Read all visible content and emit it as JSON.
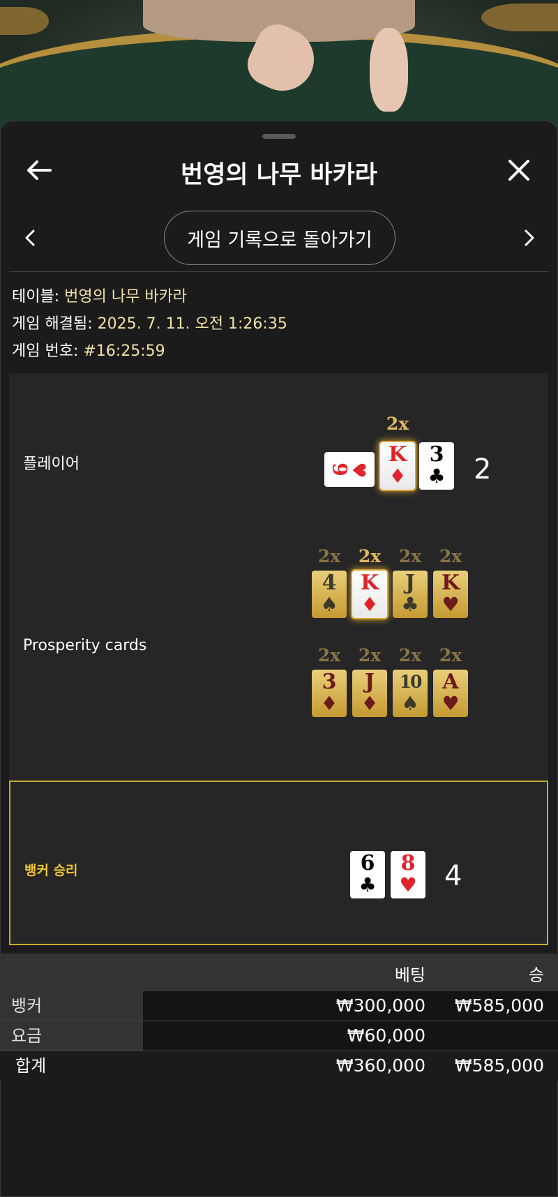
{
  "header": {
    "title": "번영의 나무 바카라",
    "back_label": "게임 기록으로 돌아가기"
  },
  "info": {
    "table_key": "테이블:",
    "table_value": "번영의 나무 바카라",
    "resolved_key": "게임 해결됨:",
    "resolved_value": "2025. 7. 11. 오전 1:26:35",
    "number_key": "게임 번호:",
    "number_value": "#16:25:59"
  },
  "player": {
    "label": "플레이어",
    "multiplier": "2x",
    "cards": [
      {
        "rank": "9",
        "suit": "♥",
        "color": "red"
      },
      {
        "rank": "K",
        "suit": "♦",
        "color": "red"
      },
      {
        "rank": "3",
        "suit": "♣",
        "color": "black"
      }
    ],
    "total": "2"
  },
  "prosperity": {
    "label": "Prosperity cards",
    "row1": [
      {
        "mult": "2x",
        "rank": "4",
        "suit": "♠"
      },
      {
        "mult": "2x",
        "rank": "K",
        "suit": "♦"
      },
      {
        "mult": "2x",
        "rank": "J",
        "suit": "♣"
      },
      {
        "mult": "2x",
        "rank": "K",
        "suit": "♥"
      }
    ],
    "row2": [
      {
        "mult": "2x",
        "rank": "3",
        "suit": "♦"
      },
      {
        "mult": "2x",
        "rank": "J",
        "suit": "♦"
      },
      {
        "mult": "2x",
        "rank": "10",
        "suit": "♠"
      },
      {
        "mult": "2x",
        "rank": "A",
        "suit": "♥"
      }
    ]
  },
  "banker": {
    "label": "뱅커 승리",
    "cards": [
      {
        "rank": "6",
        "suit": "♣",
        "color": "black"
      },
      {
        "rank": "8",
        "suit": "♥",
        "color": "red"
      }
    ],
    "total": "4"
  },
  "bets_table": {
    "headers": {
      "bet": "베팅",
      "win": "승"
    },
    "rows": [
      {
        "name": "뱅커",
        "bet": "₩300,000",
        "win": "₩585,000"
      },
      {
        "name": "요금",
        "bet": "₩60,000",
        "win": ""
      }
    ],
    "total": {
      "name": "합계",
      "bet": "₩360,000",
      "win": "₩585,000"
    }
  },
  "colors": {
    "gold_accent": "#f2c530",
    "info_value": "#f2e2a8",
    "panel_bg": "#262626"
  }
}
